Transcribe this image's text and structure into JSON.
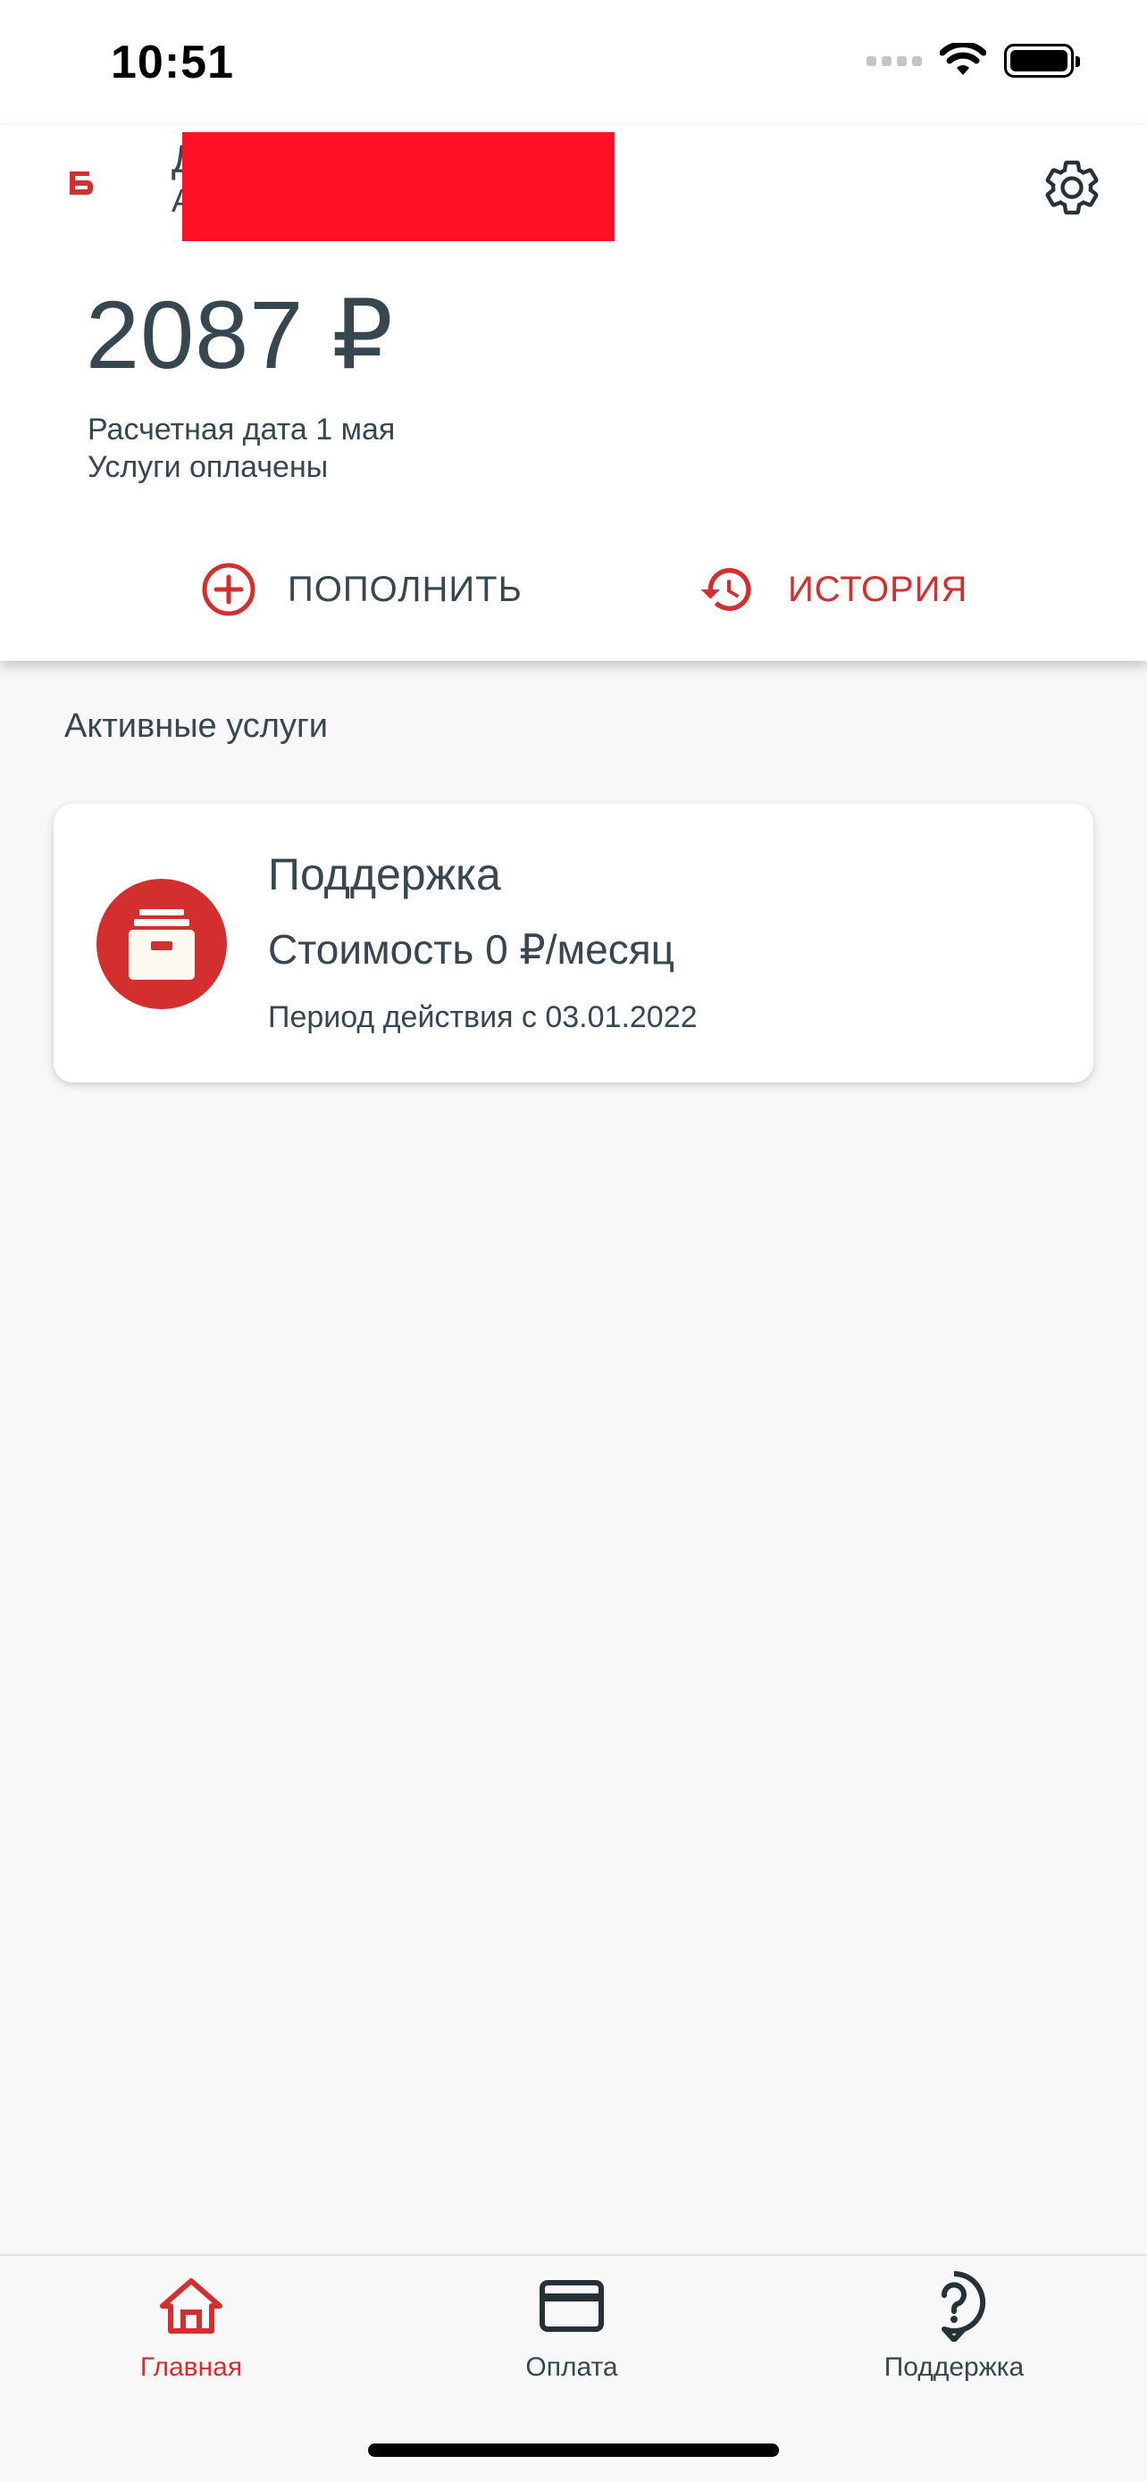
{
  "status_bar": {
    "time": "10:51"
  },
  "header": {
    "account_name": "Д",
    "account_subline": "А",
    "balance": "2087 ₽",
    "payment_date": "Расчетная дата 1 мая",
    "payment_status": "Услуги оплачены",
    "topup_label": "ПОПОЛНИТЬ",
    "history_label": "ИСТОРИЯ"
  },
  "services": {
    "section_title": "Активные услуги",
    "items": [
      {
        "name": "Поддержка",
        "price": "Стоимость 0 ₽/месяц",
        "period": "Период действия с 03.01.2022"
      }
    ]
  },
  "bottom_nav": {
    "items": [
      {
        "label": "Главная",
        "icon": "home-icon",
        "active": true
      },
      {
        "label": "Оплата",
        "icon": "credit-card-icon",
        "active": false
      },
      {
        "label": "Поддержка",
        "icon": "help-bubble-icon",
        "active": false
      }
    ]
  },
  "colors": {
    "accent": "#d32f2f",
    "text": "#37474f",
    "background": "#f8f8f8",
    "card": "#ffffff"
  }
}
